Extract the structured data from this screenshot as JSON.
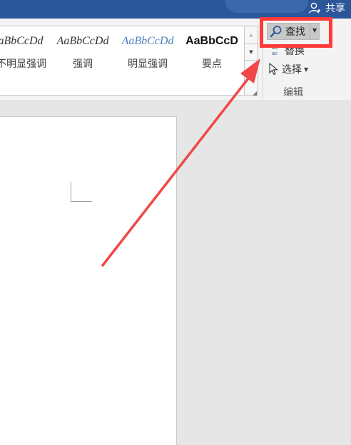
{
  "titlebar": {
    "share_label": "共享",
    "share_icon": "add-person-icon"
  },
  "styles": [
    {
      "preview": "aBbCcDd",
      "label": "不明显强调",
      "color": "#333333",
      "italic": true,
      "bold": false
    },
    {
      "preview": "AaBbCcDd",
      "label": "强调",
      "color": "#333333",
      "italic": true,
      "bold": false
    },
    {
      "preview": "AaBbCcDd",
      "label": "明显强调",
      "color": "#4a7fbf",
      "italic": true,
      "bold": false
    },
    {
      "preview": "AaBbCcD",
      "label": "要点",
      "color": "#111111",
      "italic": false,
      "bold": true
    }
  ],
  "gallery": {
    "scroll_up_icon": "up-triangle-icon",
    "scroll_down_icon": "down-triangle-icon"
  },
  "editing": {
    "find_label": "查找",
    "replace_label": "替换",
    "replace_icon_top": "ab",
    "replace_icon_bottom": "ac",
    "select_label": "选择",
    "group_label": "编辑"
  },
  "annotation": {
    "highlight_color": "#ff3a3a",
    "arrow_color": "#f04848"
  }
}
